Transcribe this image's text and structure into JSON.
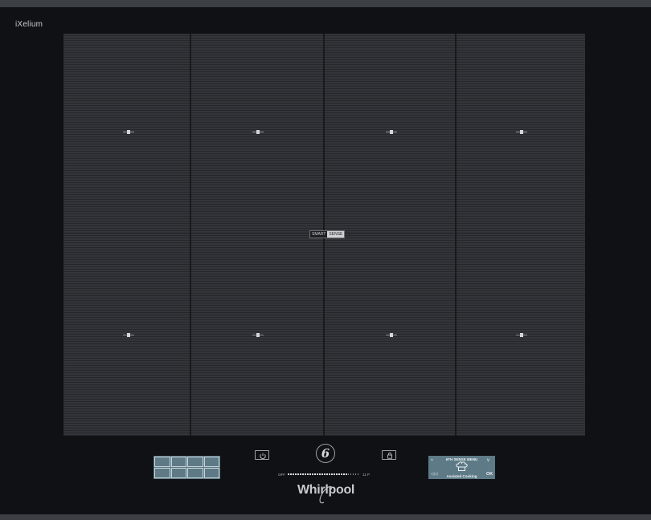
{
  "hob": {
    "series_logo": "iXelium",
    "smart_badge": {
      "left": "SMART",
      "right": "SENSE"
    },
    "zones": [
      {
        "id": "zone-1"
      },
      {
        "id": "zone-2"
      },
      {
        "id": "zone-3"
      },
      {
        "id": "zone-4"
      },
      {
        "id": "zone-5"
      },
      {
        "id": "zone-6"
      },
      {
        "id": "zone-7"
      },
      {
        "id": "zone-8"
      }
    ]
  },
  "controls": {
    "power_icon": "power-icon",
    "sixth_sense_label": "6",
    "lock_icon": "lock-icon",
    "slider": {
      "min_label": "OFF",
      "max_label": "11 P",
      "level": 0.82
    },
    "brand": "Whirlpool"
  },
  "menu_display": {
    "title": "6TH SENSE MENU",
    "subtitle": "Assisted Cooking",
    "ok_label": "OK",
    "up_arrow": "^",
    "down_arrow": "v",
    "back_label": "◁◁",
    "icon": "chef-hat-icon"
  },
  "colors": {
    "frame": "#0f1114",
    "cooking_surface": "#33353a",
    "display_panel": "#5e7a86",
    "display_text": "#eef3f5"
  }
}
